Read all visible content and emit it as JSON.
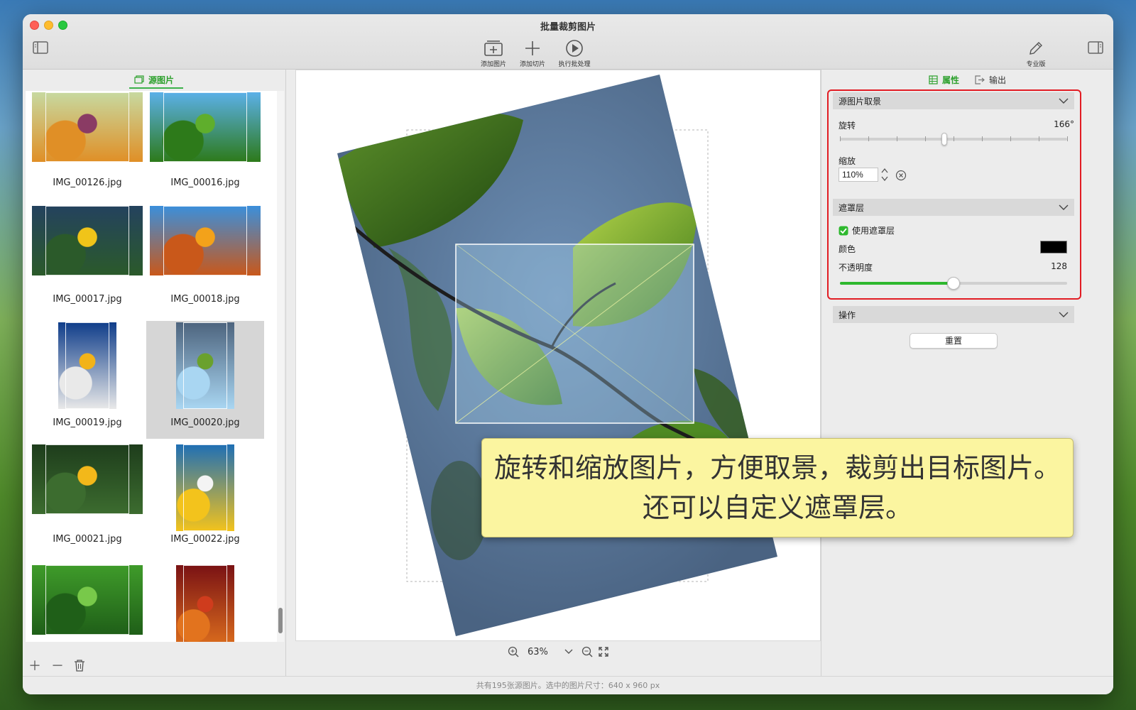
{
  "window": {
    "title": "批量裁剪图片"
  },
  "toolbar": {
    "add_image": "添加图片",
    "add_slice": "添加切片",
    "run_batch": "执行批处理",
    "pro": "专业版"
  },
  "left_panel": {
    "tab_label": "源图片",
    "thumbnails": [
      {
        "name": "IMG_00126.jpg",
        "palette": [
          "#c7d9a0",
          "#8a3b64",
          "#e08f26"
        ]
      },
      {
        "name": "IMG_00016.jpg",
        "palette": [
          "#5bb0e8",
          "#5fae2c",
          "#2d7a1a"
        ]
      },
      {
        "name": "IMG_00017.jpg",
        "palette": [
          "#24425e",
          "#f0c419",
          "#2b5a2a"
        ]
      },
      {
        "name": "IMG_00018.jpg",
        "palette": [
          "#3b8fdb",
          "#f3a21a",
          "#c9581a"
        ]
      },
      {
        "name": "IMG_00019.jpg",
        "palette": [
          "#0f3d8a",
          "#f2b319",
          "#e9e9e9"
        ]
      },
      {
        "name": "IMG_00020.jpg",
        "palette": [
          "#4d647e",
          "#6aa12d",
          "#a9d6f2"
        ]
      },
      {
        "name": "IMG_00021.jpg",
        "palette": [
          "#1e3d1c",
          "#f3b81a",
          "#3c6c2f"
        ]
      },
      {
        "name": "IMG_00022.jpg",
        "palette": [
          "#1f6fb5",
          "#f4f4f4",
          "#f3c31c"
        ]
      },
      {
        "name": "",
        "palette": [
          "#3f9b2a",
          "#78c94a",
          "#1f5f18"
        ]
      },
      {
        "name": "",
        "palette": [
          "#7a1214",
          "#cf3c1d",
          "#e2731e"
        ]
      }
    ]
  },
  "canvas": {
    "zoom": "63%"
  },
  "right_panel": {
    "tab_properties": "属性",
    "tab_output": "输出",
    "section_source": "源图片取景",
    "rotate_label": "旋转",
    "rotate_value": "166°",
    "rotate_level": 0.46,
    "scale_label": "缩放",
    "scale_value": "110%",
    "section_mask": "遮罩层",
    "use_mask_label": "使用遮罩层",
    "use_mask_checked": true,
    "color_label": "颜色",
    "mask_color": "#000000",
    "opacity_label": "不透明度",
    "opacity_value": "128",
    "opacity_level": 0.5,
    "section_ops": "操作",
    "reset_label": "重置"
  },
  "status": {
    "text": "共有195张源图片。选中的图片尺寸：640 x 960 px"
  },
  "callout": {
    "line1": "旋转和缩放图片，方便取景，裁剪出目标图片。",
    "line2": "还可以自定义遮罩层。"
  },
  "colors": {
    "accent_green": "#2eb82e",
    "highlight_red": "#e21c23",
    "callout_bg": "#fbf5a0"
  }
}
